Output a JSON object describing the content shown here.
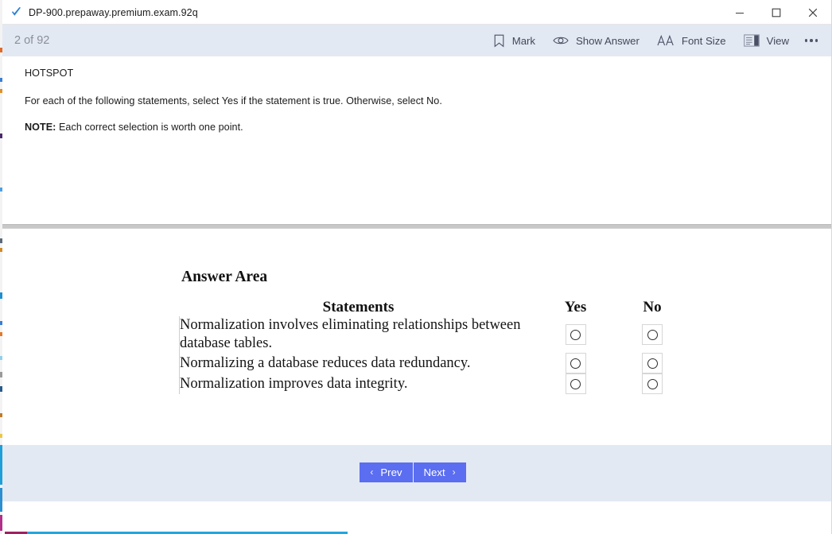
{
  "window": {
    "tab_title": "DP-900.prepaway.premium.exam.92q",
    "tab_icon": "checkmark-icon",
    "controls": {
      "minimize": "minimize-icon",
      "maximize": "maximize-icon",
      "close": "close-icon"
    }
  },
  "toolbar": {
    "page_counter": "2 of 92",
    "actions": [
      {
        "label": "Mark",
        "icon": "bookmark-icon"
      },
      {
        "label": "Show Answer",
        "icon": "eye-icon"
      },
      {
        "label": "Font Size",
        "icon": "font-size-icon"
      },
      {
        "label": "View",
        "icon": "view-panel-icon"
      }
    ],
    "more_label": "more-options-icon"
  },
  "question": {
    "type_label": "HOTSPOT",
    "instruction": "For each of the following statements, select Yes if the statement is true. Otherwise, select No.",
    "note_prefix": "NOTE:",
    "note_text": " Each correct selection is worth one point."
  },
  "answer_area": {
    "title": "Answer Area",
    "headers": {
      "statements": "Statements",
      "yes": "Yes",
      "no": "No"
    },
    "rows": [
      {
        "statement": "Normalization involves eliminating relationships between database tables.",
        "yes_selected": false,
        "no_selected": false
      },
      {
        "statement": "Normalizing a database reduces data redundancy.",
        "yes_selected": false,
        "no_selected": false
      },
      {
        "statement": "Normalization improves data integrity.",
        "yes_selected": false,
        "no_selected": false
      }
    ]
  },
  "navigation": {
    "prev_label": "Prev",
    "next_label": "Next",
    "prev_chevron": "‹",
    "next_chevron": "›"
  },
  "colors": {
    "toolbar_bg": "#e3e9f3",
    "nav_button": "#5b6df0",
    "tab_icon_blue": "#2b7fd4",
    "strip_cyan": "#22a6dd",
    "strip_magenta": "#a02060"
  }
}
